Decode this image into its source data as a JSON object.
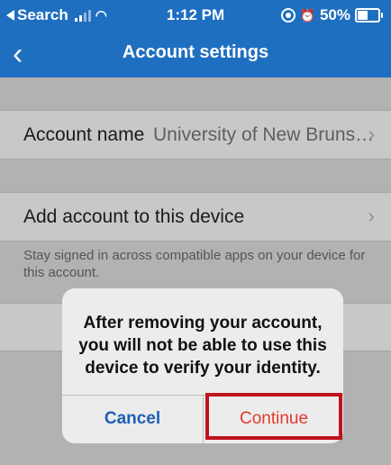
{
  "status_bar": {
    "back_app": "Search",
    "time": "1:12 PM",
    "battery": "50%"
  },
  "nav": {
    "back_icon": "chevron-left-icon",
    "title": "Account settings"
  },
  "rows": {
    "account_name": {
      "label": "Account name",
      "value": "University of New Bruns…"
    },
    "add_account": {
      "label": "Add account to this device"
    },
    "add_account_note": "Stay signed in across compatible apps on your device for this account."
  },
  "dialog": {
    "message_line1": "After removing your account,",
    "message_line2": "you will not be able to use this",
    "message_line3": "device to verify your identity.",
    "cancel_label": "Cancel",
    "continue_label": "Continue"
  },
  "colors": {
    "nav_background": "#1f6fc0",
    "cancel": "#1f5fb5",
    "continue": "#e3392d",
    "highlight_border": "#c0131c"
  }
}
